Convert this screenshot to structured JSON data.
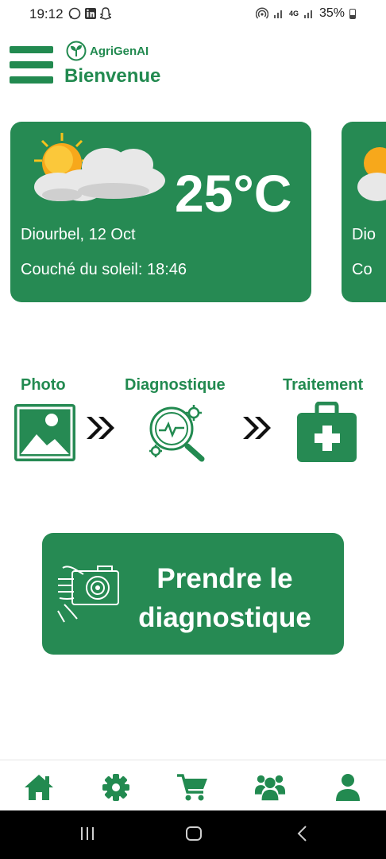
{
  "status_bar": {
    "time": "19:12",
    "network": "4G",
    "battery": "35%"
  },
  "header": {
    "brand": "AgriGenAI",
    "welcome": "Bienvenue"
  },
  "weather": {
    "temperature": "25°C",
    "location_date": "Diourbel, 12 Oct",
    "sunset": "Couché du soleil: 18:46",
    "next_location": "Dio",
    "next_sunset": "Co"
  },
  "steps": [
    {
      "label": "Photo",
      "icon": "image-icon"
    },
    {
      "label": "Diagnostique",
      "icon": "diagnostic-magnifier-icon"
    },
    {
      "label": "Traitement",
      "icon": "first-aid-kit-icon"
    }
  ],
  "cta": {
    "label_line1": "Prendre le",
    "label_line2": "diagnostique",
    "icon": "camera-hand-icon"
  },
  "bottom_nav": [
    "home-icon",
    "gear-icon",
    "cart-icon",
    "group-icon",
    "user-icon"
  ],
  "colors": {
    "brand_green": "#268a53",
    "text_green": "#228a50",
    "white": "#ffffff"
  }
}
